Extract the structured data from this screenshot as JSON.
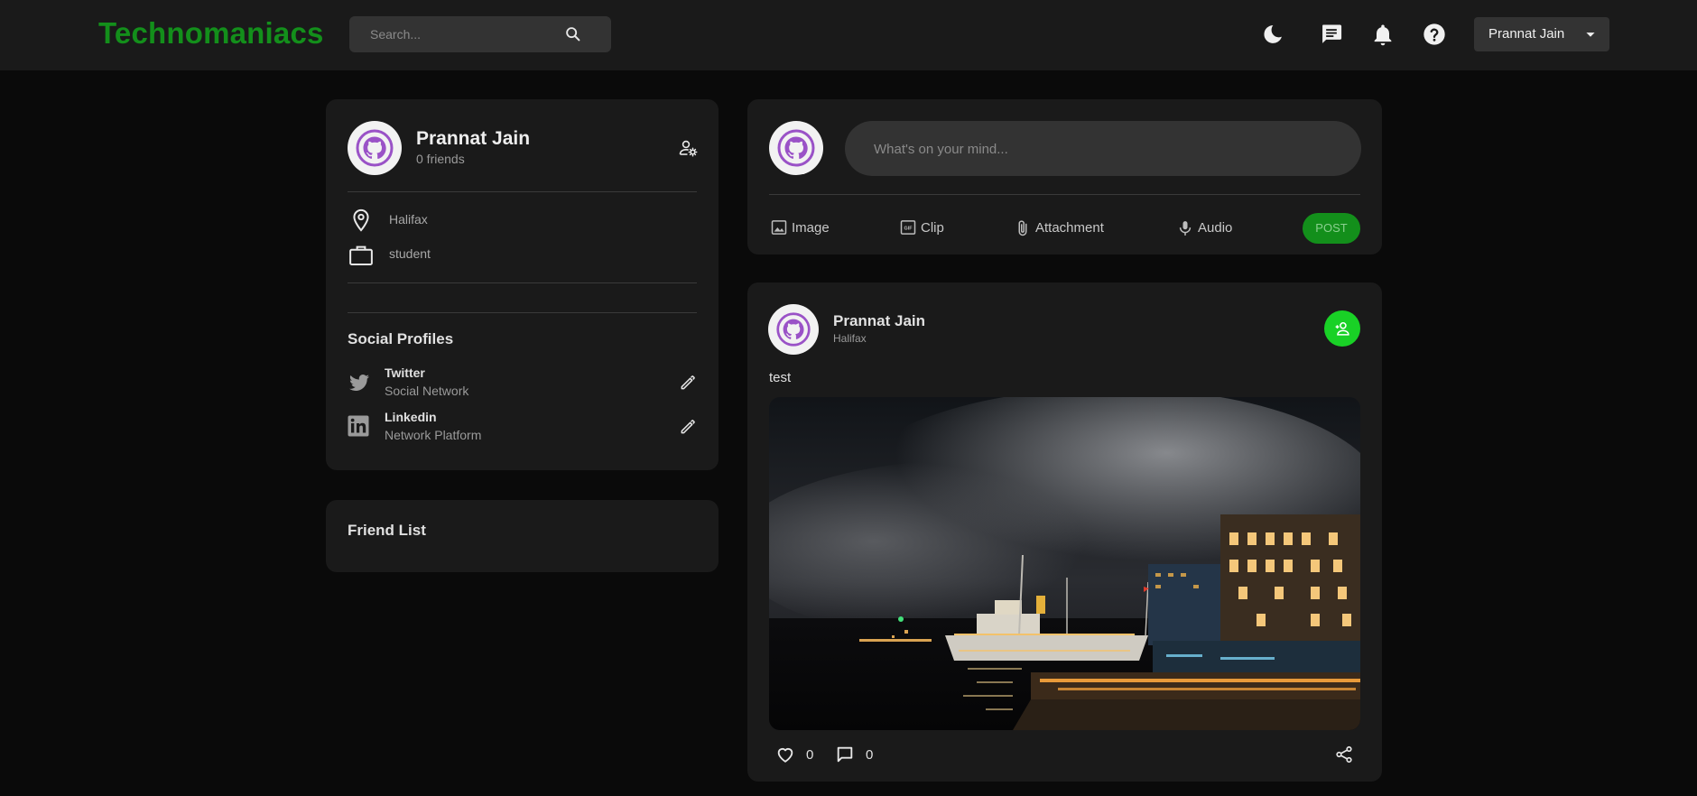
{
  "app": {
    "brand": "Technomaniacs",
    "brand_color": "#138f1b",
    "search": {
      "placeholder": "Search..."
    },
    "nav_icons": [
      "moon-icon",
      "chat-icon",
      "bell-icon",
      "help-icon"
    ],
    "user_menu": {
      "label": "Prannat Jain"
    }
  },
  "profile": {
    "name": "Prannat Jain",
    "friends": "0 friends",
    "location": "Halifax",
    "occupation": "student",
    "social_title": "Social Profiles",
    "socials": [
      {
        "name": "Twitter",
        "type": "Social Network",
        "icon": "twitter-icon"
      },
      {
        "name": "Linkedin",
        "type": "Network Platform",
        "icon": "linkedin-icon"
      }
    ]
  },
  "friend_list": {
    "title": "Friend List"
  },
  "composer": {
    "placeholder": "What's on your mind...",
    "actions": [
      {
        "label": "Image",
        "icon": "image-icon"
      },
      {
        "label": "Clip",
        "icon": "gif-icon"
      },
      {
        "label": "Attachment",
        "icon": "paperclip-icon"
      },
      {
        "label": "Audio",
        "icon": "microphone-icon"
      }
    ],
    "post_label": "POST"
  },
  "post": {
    "author": "Prannat Jain",
    "location": "Halifax",
    "text": "test",
    "likes": "0",
    "comments": "0",
    "add_friend_color": "#19d126"
  }
}
